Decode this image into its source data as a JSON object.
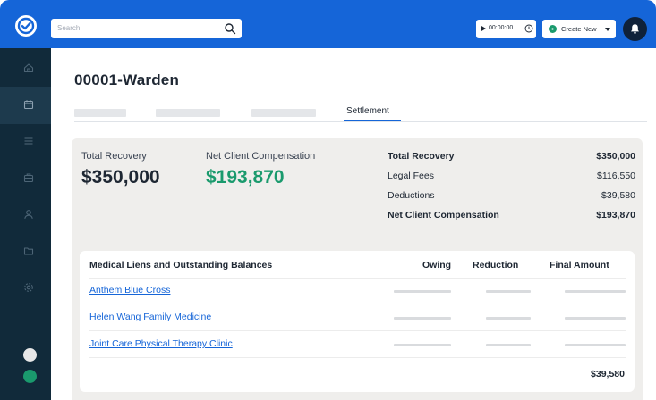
{
  "colors": {
    "primary": "#1565d8",
    "sidebar": "#112a3a",
    "positive": "#1a9a6d",
    "panel": "#efeeec",
    "status_light": "#e7e7e7",
    "status_green": "#1a9a6d"
  },
  "topbar": {
    "logo_icon": "check-circle-icon",
    "search_placeholder": "Search",
    "timer": "00:00:00",
    "create_label": "Create New"
  },
  "sidebar": {
    "items": [
      {
        "icon": "home-icon",
        "active": false
      },
      {
        "icon": "calendar-icon",
        "active": true
      },
      {
        "icon": "list-icon",
        "active": false
      },
      {
        "icon": "briefcase-icon",
        "active": false
      },
      {
        "icon": "user-icon",
        "active": false
      },
      {
        "icon": "folder-icon",
        "active": false
      },
      {
        "icon": "settings-icon",
        "active": false
      }
    ]
  },
  "page": {
    "title": "00001-Warden",
    "active_tab": "Settlement"
  },
  "summary": {
    "total_recovery_label": "Total Recovery",
    "total_recovery_value": "$350,000",
    "net_comp_label": "Net Client Compensation",
    "net_comp_value": "$193,870",
    "breakdown": [
      {
        "label": "Total Recovery",
        "value": "$350,000",
        "bold": true
      },
      {
        "label": "Legal Fees",
        "value": "$116,550",
        "bold": false
      },
      {
        "label": "Deductions",
        "value": "$39,580",
        "bold": false
      },
      {
        "label": "Net Client Compensation",
        "value": "$193,870",
        "bold": true
      }
    ]
  },
  "liens": {
    "headers": {
      "name": "Medical Liens and Outstanding Balances",
      "owing": "Owing",
      "reduction": "Reduction",
      "final": "Final Amount"
    },
    "rows": [
      {
        "name": "Anthem Blue Cross"
      },
      {
        "name": "Helen Wang Family Medicine"
      },
      {
        "name": "Joint Care Physical Therapy Clinic"
      }
    ],
    "total": "$39,580"
  }
}
